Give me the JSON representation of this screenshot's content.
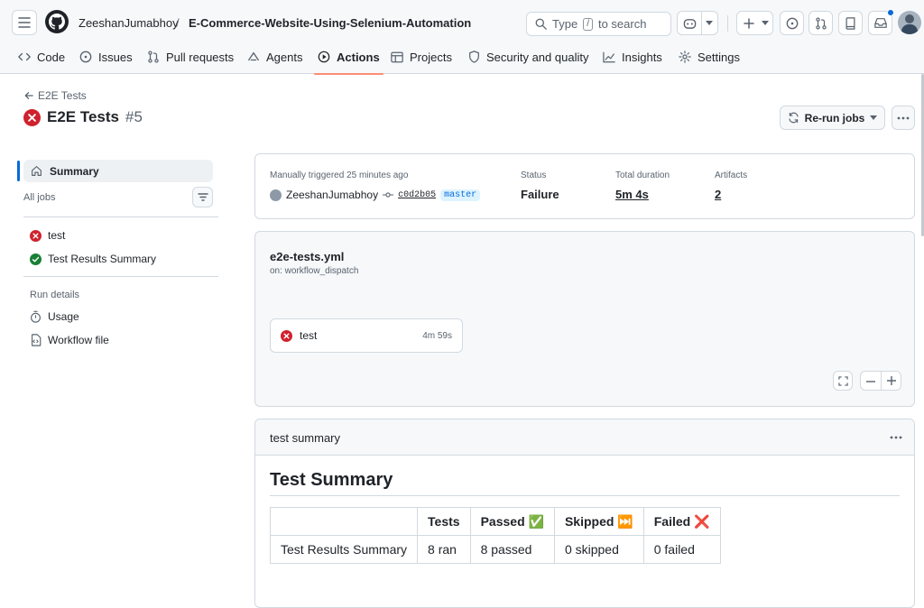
{
  "header": {
    "owner": "ZeeshanJumabhoy",
    "separator": "/",
    "repo": "E-Commerce-Website-Using-Selenium-Automation",
    "search_prefix": "Type",
    "search_key": "/",
    "search_suffix": "to search"
  },
  "nav": {
    "tabs": [
      {
        "label": "Code",
        "icon": "code-icon"
      },
      {
        "label": "Issues",
        "icon": "issue-icon"
      },
      {
        "label": "Pull requests",
        "icon": "pull-request-icon"
      },
      {
        "label": "Agents",
        "icon": "agents-icon"
      },
      {
        "label": "Actions",
        "icon": "play-icon",
        "active": true
      },
      {
        "label": "Projects",
        "icon": "table-icon"
      },
      {
        "label": "Security and quality",
        "icon": "shield-icon"
      },
      {
        "label": "Insights",
        "icon": "graph-icon"
      },
      {
        "label": "Settings",
        "icon": "gear-icon"
      }
    ]
  },
  "run": {
    "back_label": "E2E Tests",
    "title": "E2E Tests",
    "number": "#5",
    "rerun_label": "Re-run jobs"
  },
  "sidebar": {
    "summary_label": "Summary",
    "all_jobs_label": "All jobs",
    "jobs": [
      {
        "label": "test",
        "status": "failure"
      },
      {
        "label": "Test Results Summary",
        "status": "success"
      }
    ],
    "run_details_label": "Run details",
    "details": [
      {
        "label": "Usage",
        "icon": "stopwatch-icon"
      },
      {
        "label": "Workflow file",
        "icon": "file-code-icon"
      }
    ]
  },
  "summary": {
    "trigger": "Manually triggered 25 minutes ago",
    "user": "ZeeshanJumabhoy",
    "commit": "c0d2b05",
    "branch": "master",
    "status_label": "Status",
    "status_value": "Failure",
    "duration_label": "Total duration",
    "duration_value": "5m 4s",
    "artifacts_label": "Artifacts",
    "artifacts_value": "2"
  },
  "workflow": {
    "file": "e2e-tests.yml",
    "trigger": "on: workflow_dispatch",
    "job": {
      "label": "test",
      "duration": "4m 59s"
    }
  },
  "test_summary": {
    "section_title": "test summary",
    "heading": "Test Summary",
    "columns": [
      "",
      "Tests",
      "Passed ✅",
      "Skipped ⏭️",
      "Failed ❌"
    ],
    "rows": [
      [
        "Test Results Summary",
        "8 ran",
        "8 passed",
        "0 skipped",
        "0 failed"
      ]
    ]
  },
  "colors": {
    "failure": "#cf222e",
    "success": "#1a7f37",
    "accent": "#0969da",
    "tab_underline": "#fd8c73"
  }
}
